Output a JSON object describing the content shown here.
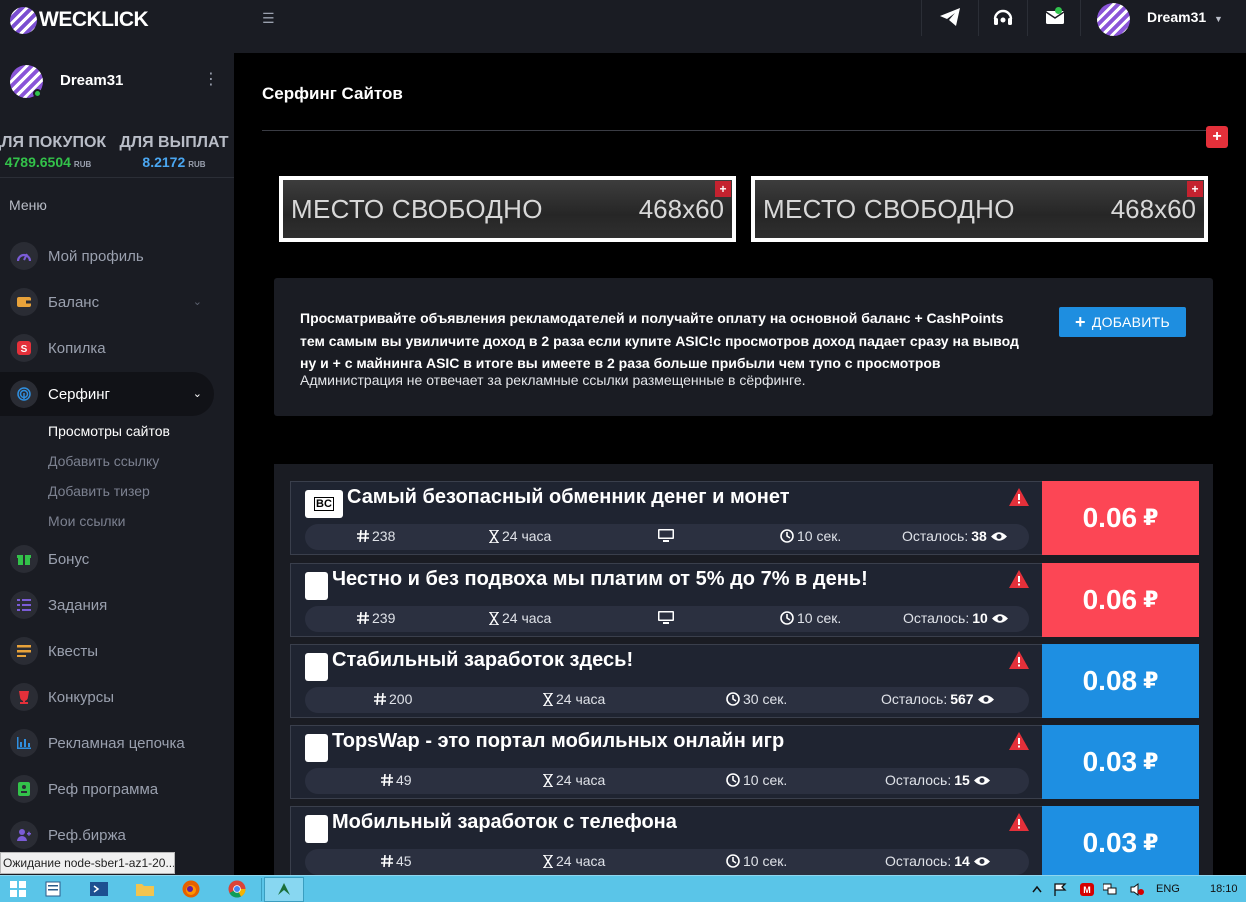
{
  "brand": {
    "name": "WECKLICK"
  },
  "user": {
    "name": "Dream31"
  },
  "balances": [
    {
      "label": "ДЛЯ ПОКУПОК",
      "value": "4789.6504",
      "unit": "RUB",
      "color": "#33c24a"
    },
    {
      "label": "ДЛЯ ВЫПЛАТ",
      "value": "8.2172",
      "unit": "RUB",
      "color": "#4aa6f0"
    }
  ],
  "menu": {
    "title": "Меню",
    "items": [
      {
        "label": "Мой профиль",
        "icon": "gauge-icon",
        "color": "#7b5cd6"
      },
      {
        "label": "Баланс",
        "icon": "wallet-icon",
        "color": "#e8a23a"
      },
      {
        "label": "Копилка",
        "icon": "piggy-icon",
        "color": "#e4303a"
      },
      {
        "label": "Серфинг",
        "icon": "fingerprint-icon",
        "color": "#2f8fe0"
      },
      {
        "label": "Бонус",
        "icon": "gift-icon",
        "color": "#33c24a"
      },
      {
        "label": "Задания",
        "icon": "tasks-icon",
        "color": "#7b5cd6"
      },
      {
        "label": "Квесты",
        "icon": "quest-icon",
        "color": "#e8a23a"
      },
      {
        "label": "Конкурсы",
        "icon": "trophy-icon",
        "color": "#e4303a"
      },
      {
        "label": "Рекламная цепочка",
        "icon": "chart-icon",
        "color": "#2f8fe0"
      },
      {
        "label": "Реф программа",
        "icon": "ref-icon",
        "color": "#33c24a"
      },
      {
        "label": "Реф.биржа",
        "icon": "users-icon",
        "color": "#7b5cd6"
      }
    ],
    "submenu": [
      "Просмотры сайтов",
      "Добавить ссылку",
      "Добавить тизер",
      "Мои ссылки"
    ]
  },
  "page": {
    "title": "Серфинг Сайтов",
    "ads": [
      {
        "left": "МЕСТО СВОБОДНО",
        "right": "468x60"
      },
      {
        "left": "МЕСТО СВОБОДНО",
        "right": "468x60"
      }
    ],
    "info": {
      "line1": "Просматривайте объявления рекламодателей и получайте оплату на основной баланс + CashPoints",
      "line2": "тем самым вы увиличите доход в 2 раза если купите ASIC!с просмотров доход падает сразу на вывод",
      "line3": "ну и + с майнинга ASIC в итоге вы имеете в 2 раза больше прибыли чем тупо с просмотров",
      "note": "Администрация не отвечает за рекламные ссылки размещенные в сёрфинге.",
      "add_button": "ДОБАВИТЬ"
    },
    "tasks": [
      {
        "title": "Самый безопасный обменник денег и монет",
        "favicon": "BC",
        "id": "238",
        "duration": "24 часа",
        "has_monitor": true,
        "timer": "10 сек.",
        "left_label": "Осталось:",
        "left_count": "38",
        "price": "0.06",
        "currency": "₽",
        "price_color": "#fc4655"
      },
      {
        "title": "Честно и без подвоха мы платим от 5% до 7% в день!",
        "favicon": "",
        "id": "239",
        "duration": "24 часа",
        "has_monitor": true,
        "timer": "10 сек.",
        "left_label": "Осталось:",
        "left_count": "10",
        "price": "0.06",
        "currency": "₽",
        "price_color": "#fc4655"
      },
      {
        "title": "Стабильный заработок здесь!",
        "favicon": "",
        "id": "200",
        "duration": "24 часа",
        "has_monitor": false,
        "timer": "30 сек.",
        "left_label": "Осталось:",
        "left_count": "567",
        "price": "0.08",
        "currency": "₽",
        "price_color": "#1e8fe2"
      },
      {
        "title": "TopsWap - это портал мобильных онлайн игр",
        "favicon": "",
        "id": "49",
        "duration": "24 часа",
        "has_monitor": false,
        "timer": "10 сек.",
        "left_label": "Осталось:",
        "left_count": "15",
        "price": "0.03",
        "currency": "₽",
        "price_color": "#1e8fe2"
      },
      {
        "title": "Мобильный заработок с телефона",
        "favicon": "",
        "id": "45",
        "duration": "24 часа",
        "has_monitor": false,
        "timer": "10 сек.",
        "left_label": "Осталось:",
        "left_count": "14",
        "price": "0.03",
        "currency": "₽",
        "price_color": "#1e8fe2"
      }
    ]
  },
  "browser_status": "Ожидание node-sber1-az1-20...",
  "taskbar": {
    "lang": "ENG",
    "time": "18:10"
  }
}
